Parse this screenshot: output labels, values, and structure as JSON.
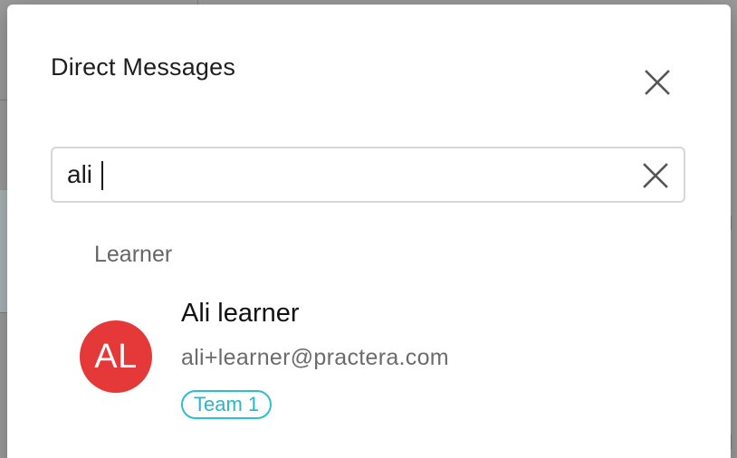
{
  "dialog": {
    "title": "Direct Messages",
    "close_icon": "close-icon"
  },
  "search": {
    "value": "ali",
    "clear_icon": "clear-icon"
  },
  "results": {
    "section_label": "Learner",
    "items": [
      {
        "avatar_initials": "AL",
        "avatar_color": "#e53838",
        "name": "Ali learner",
        "email": "ali+learner@practera.com",
        "team": "Team 1",
        "team_color": "#2bbfcf"
      }
    ]
  }
}
